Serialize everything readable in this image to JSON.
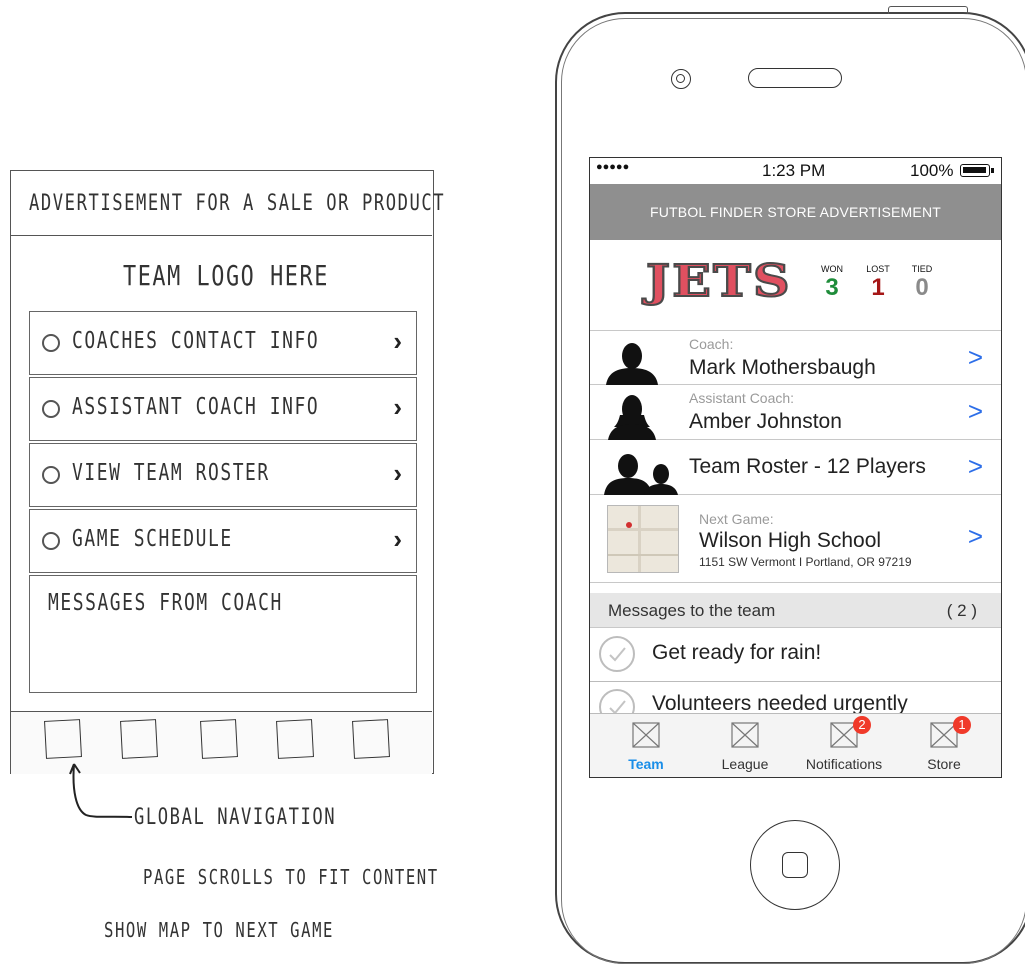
{
  "sketch": {
    "advertisement": "ADVERTISEMENT FOR A SALE OR PRODUCT",
    "team_logo": "TEAM LOGO HERE",
    "menu_items": [
      {
        "label": "COACHES CONTACT INFO"
      },
      {
        "label": "ASSISTANT COACH INFO"
      },
      {
        "label": "VIEW TEAM ROSTER"
      },
      {
        "label": "GAME SCHEDULE"
      }
    ],
    "messages": "MESSAGES FROM COACH",
    "annotations": {
      "global_nav": "GLOBAL NAVIGATION",
      "page_scrolls": "PAGE SCROLLS TO FIT CONTENT",
      "show_map": "SHOW MAP TO NEXT GAME"
    }
  },
  "status_bar": {
    "signal": "●●●●●",
    "time": "1:23 PM",
    "battery": "100%"
  },
  "ad_banner": "FUTBOL FINDER STORE ADVERTISEMENT",
  "team": {
    "logo_text": "JETS",
    "record": [
      {
        "label": "WON",
        "value": "3",
        "color": "#1e8c3a"
      },
      {
        "label": "LOST",
        "value": "1",
        "color": "#a51616"
      },
      {
        "label": "TIED",
        "value": "0",
        "color": "#8a8a8a"
      }
    ]
  },
  "rows": {
    "coach": {
      "sublabel": "Coach:",
      "name": "Mark Mothersbaugh"
    },
    "assistant": {
      "sublabel": "Assistant Coach:",
      "name": "Amber Johnston"
    },
    "roster": {
      "name": "Team Roster - 12 Players"
    },
    "next_game": {
      "sublabel": "Next Game:",
      "name": "Wilson High School",
      "address": "1151 SW Vermont I Portland, OR 97219"
    }
  },
  "messages": {
    "header": "Messages to the team",
    "count": "( 2 )",
    "items": [
      {
        "text": "Get ready for rain!"
      },
      {
        "text": "Volunteers needed urgently"
      }
    ]
  },
  "tabs": [
    {
      "label": "Team",
      "active": true,
      "badge": ""
    },
    {
      "label": "League",
      "active": false,
      "badge": ""
    },
    {
      "label": "Notifications",
      "active": false,
      "badge": "2"
    },
    {
      "label": "Store",
      "active": false,
      "badge": "1"
    }
  ],
  "colors": {
    "accent_blue": "#2d6ee8",
    "tab_active": "#1a8ee8",
    "badge_red": "#f03a2a",
    "ad_gray": "#8f8f8f"
  }
}
